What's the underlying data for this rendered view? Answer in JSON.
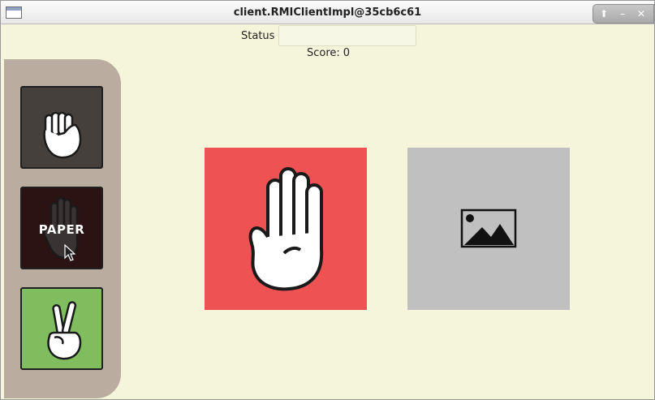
{
  "window": {
    "title": "client.RMIClientImpl@35cb6c61"
  },
  "header": {
    "status_label": "Status",
    "status_value": "",
    "score_label": "Score:",
    "score_value": "0"
  },
  "choices": [
    {
      "name": "rock",
      "icon": "fist-icon",
      "color": "#46403c",
      "label": ""
    },
    {
      "name": "paper",
      "icon": "open-hand-icon",
      "color": "#2b1213",
      "label": "PAPER"
    },
    {
      "name": "scissors",
      "icon": "peace-hand-icon",
      "color": "#7fbd5f",
      "label": ""
    }
  ],
  "play_area": {
    "player_card": {
      "icon": "open-hand-icon",
      "color": "#ef5253"
    },
    "opponent_card": {
      "icon": "image-placeholder-icon",
      "color": "#c0c0c0"
    }
  }
}
